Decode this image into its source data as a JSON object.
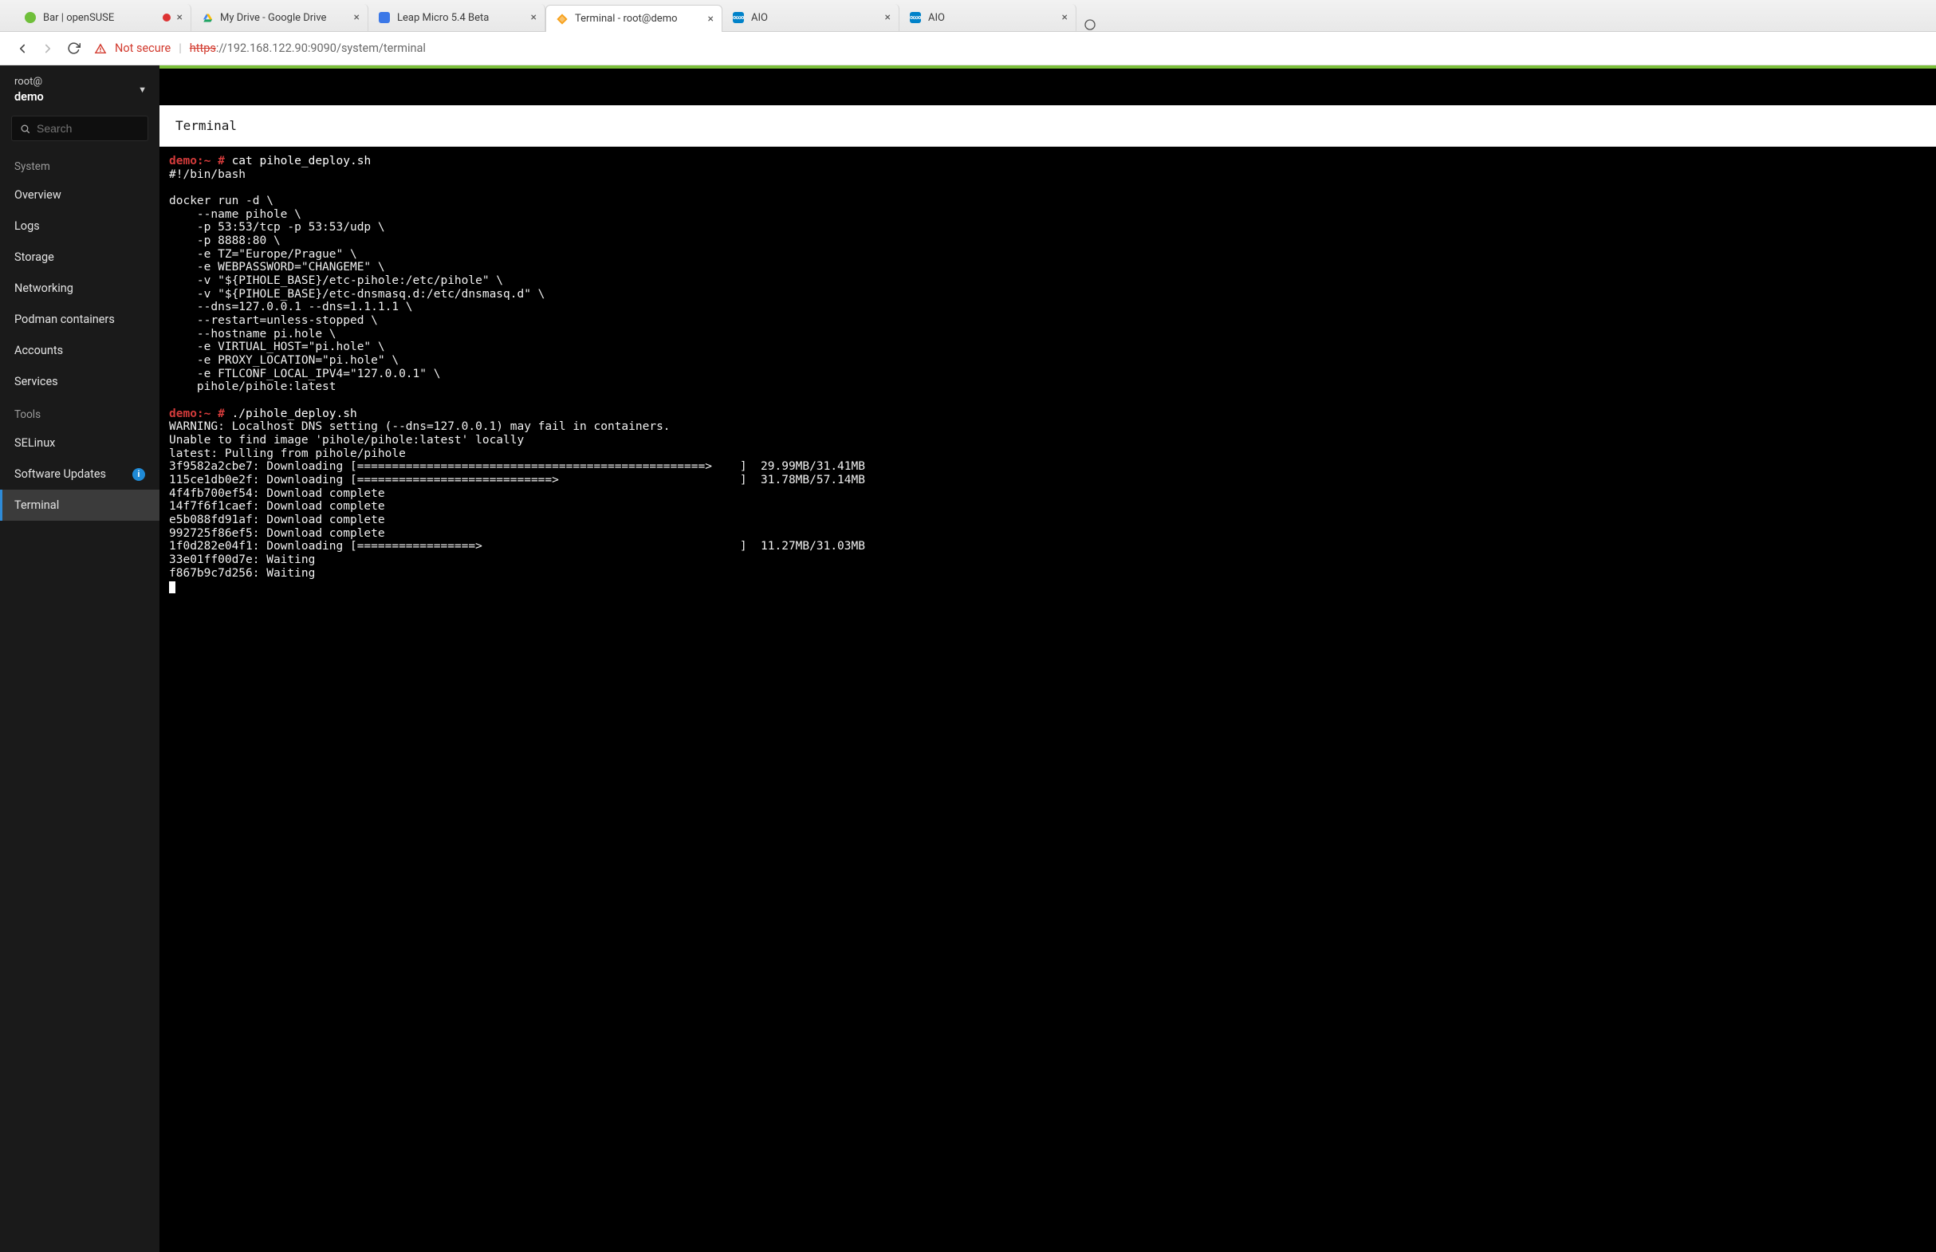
{
  "browser": {
    "tabs": [
      {
        "title": "Bar | openSUSE",
        "favicon": "opensuse"
      },
      {
        "title": "My Drive - Google Drive",
        "favicon": "gdrive"
      },
      {
        "title": "Leap Micro 5.4 Beta",
        "favicon": "gdoc"
      },
      {
        "title": "Terminal - root@demo",
        "favicon": "cockpit",
        "active": true
      },
      {
        "title": "AIO",
        "favicon": "nextcloud"
      },
      {
        "title": "AIO",
        "favicon": "nextcloud"
      }
    ],
    "address": {
      "not_secure_label": "Not secure",
      "scheme": "https",
      "host": "://192.168.122.90:9090",
      "path": "/system/terminal"
    }
  },
  "sidebar": {
    "user": "root@",
    "host": "demo",
    "search_placeholder": "Search",
    "sections": [
      {
        "label": "System",
        "items": [
          {
            "id": "overview",
            "label": "Overview"
          },
          {
            "id": "logs",
            "label": "Logs"
          },
          {
            "id": "storage",
            "label": "Storage"
          },
          {
            "id": "networking",
            "label": "Networking"
          },
          {
            "id": "podman",
            "label": "Podman containers"
          },
          {
            "id": "accounts",
            "label": "Accounts"
          },
          {
            "id": "services",
            "label": "Services"
          }
        ]
      },
      {
        "label": "Tools",
        "items": [
          {
            "id": "selinux",
            "label": "SELinux"
          },
          {
            "id": "updates",
            "label": "Software Updates",
            "badge": "info"
          },
          {
            "id": "terminal",
            "label": "Terminal",
            "active": true
          }
        ]
      }
    ]
  },
  "terminal": {
    "header": "Terminal",
    "prompt": "demo:~ #",
    "commands": {
      "cat": "cat pihole_deploy.sh",
      "run": "./pihole_deploy.sh"
    },
    "script_lines": [
      "#!/bin/bash",
      "",
      "docker run -d \\",
      "    --name pihole \\",
      "    -p 53:53/tcp -p 53:53/udp \\",
      "    -p 8888:80 \\",
      "    -e TZ=\"Europe/Prague\" \\",
      "    -e WEBPASSWORD=\"CHANGEME\" \\",
      "    -v \"${PIHOLE_BASE}/etc-pihole:/etc/pihole\" \\",
      "    -v \"${PIHOLE_BASE}/etc-dnsmasq.d:/etc/dnsmasq.d\" \\",
      "    --dns=127.0.0.1 --dns=1.1.1.1 \\",
      "    --restart=unless-stopped \\",
      "    --hostname pi.hole \\",
      "    -e VIRTUAL_HOST=\"pi.hole\" \\",
      "    -e PROXY_LOCATION=\"pi.hole\" \\",
      "    -e FTLCONF_LOCAL_IPV4=\"127.0.0.1\" \\",
      "    pihole/pihole:latest"
    ],
    "run_output": {
      "warning": "WARNING: Localhost DNS setting (--dns=127.0.0.1) may fail in containers.",
      "not_found": "Unable to find image 'pihole/pihole:latest' locally",
      "pulling": "latest: Pulling from pihole/pihole",
      "layers": [
        {
          "id": "3f9582a2cbe7",
          "status": "Downloading",
          "bar": "[==================================================>    ]",
          "size": "29.99MB/31.41MB"
        },
        {
          "id": "115ce1db0e2f",
          "status": "Downloading",
          "bar": "[============================>                          ]",
          "size": "31.78MB/57.14MB"
        },
        {
          "id": "4f4fb700ef54",
          "status": "Download complete"
        },
        {
          "id": "14f7f6f1caef",
          "status": "Download complete"
        },
        {
          "id": "e5b088fd91af",
          "status": "Download complete"
        },
        {
          "id": "992725f86ef5",
          "status": "Download complete"
        },
        {
          "id": "1f0d282e04f1",
          "status": "Downloading",
          "bar": "[=================>                                     ]",
          "size": "11.27MB/31.03MB"
        },
        {
          "id": "33e01ff00d7e",
          "status": "Waiting"
        },
        {
          "id": "f867b9c7d256",
          "status": "Waiting"
        }
      ]
    }
  }
}
